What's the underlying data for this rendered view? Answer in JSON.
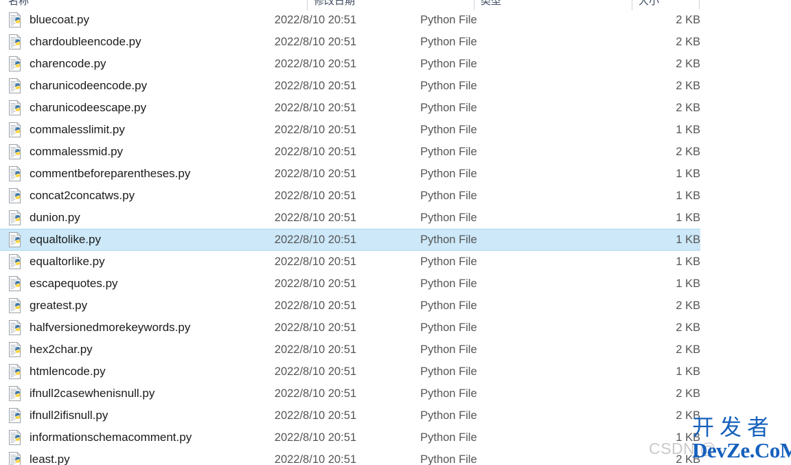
{
  "window": {
    "view": "details",
    "accent_selection_bg": "#cce8f9",
    "accent_selection_border": "#a8d8f0",
    "header_text_color": "#3b4a5e"
  },
  "columns": [
    {
      "key": "name",
      "label": "名称"
    },
    {
      "key": "date",
      "label": "修改日期"
    },
    {
      "key": "type",
      "label": "类型"
    },
    {
      "key": "size",
      "label": "大小"
    }
  ],
  "files": [
    {
      "icon": "python-file-icon",
      "name": "bluecoat.py",
      "date": "2022/8/10 20:51",
      "type": "Python File",
      "size": "2 KB",
      "selected": false
    },
    {
      "icon": "python-file-icon",
      "name": "chardoubleencode.py",
      "date": "2022/8/10 20:51",
      "type": "Python File",
      "size": "2 KB",
      "selected": false
    },
    {
      "icon": "python-file-icon",
      "name": "charencode.py",
      "date": "2022/8/10 20:51",
      "type": "Python File",
      "size": "2 KB",
      "selected": false
    },
    {
      "icon": "python-file-icon",
      "name": "charunicodeencode.py",
      "date": "2022/8/10 20:51",
      "type": "Python File",
      "size": "2 KB",
      "selected": false
    },
    {
      "icon": "python-file-icon",
      "name": "charunicodeescape.py",
      "date": "2022/8/10 20:51",
      "type": "Python File",
      "size": "2 KB",
      "selected": false
    },
    {
      "icon": "python-file-icon",
      "name": "commalesslimit.py",
      "date": "2022/8/10 20:51",
      "type": "Python File",
      "size": "1 KB",
      "selected": false
    },
    {
      "icon": "python-file-icon",
      "name": "commalessmid.py",
      "date": "2022/8/10 20:51",
      "type": "Python File",
      "size": "2 KB",
      "selected": false
    },
    {
      "icon": "python-file-icon",
      "name": "commentbeforeparentheses.py",
      "date": "2022/8/10 20:51",
      "type": "Python File",
      "size": "1 KB",
      "selected": false
    },
    {
      "icon": "python-file-icon",
      "name": "concat2concatws.py",
      "date": "2022/8/10 20:51",
      "type": "Python File",
      "size": "1 KB",
      "selected": false
    },
    {
      "icon": "python-file-icon",
      "name": "dunion.py",
      "date": "2022/8/10 20:51",
      "type": "Python File",
      "size": "1 KB",
      "selected": false
    },
    {
      "icon": "python-file-icon",
      "name": "equaltolike.py",
      "date": "2022/8/10 20:51",
      "type": "Python File",
      "size": "1 KB",
      "selected": true
    },
    {
      "icon": "python-file-icon",
      "name": "equaltorlike.py",
      "date": "2022/8/10 20:51",
      "type": "Python File",
      "size": "1 KB",
      "selected": false
    },
    {
      "icon": "python-file-icon",
      "name": "escapequotes.py",
      "date": "2022/8/10 20:51",
      "type": "Python File",
      "size": "1 KB",
      "selected": false
    },
    {
      "icon": "python-file-icon",
      "name": "greatest.py",
      "date": "2022/8/10 20:51",
      "type": "Python File",
      "size": "2 KB",
      "selected": false
    },
    {
      "icon": "python-file-icon",
      "name": "halfversionedmorekeywords.py",
      "date": "2022/8/10 20:51",
      "type": "Python File",
      "size": "2 KB",
      "selected": false
    },
    {
      "icon": "python-file-icon",
      "name": "hex2char.py",
      "date": "2022/8/10 20:51",
      "type": "Python File",
      "size": "2 KB",
      "selected": false
    },
    {
      "icon": "python-file-icon",
      "name": "htmlencode.py",
      "date": "2022/8/10 20:51",
      "type": "Python File",
      "size": "1 KB",
      "selected": false
    },
    {
      "icon": "python-file-icon",
      "name": "ifnull2casewhenisnull.py",
      "date": "2022/8/10 20:51",
      "type": "Python File",
      "size": "2 KB",
      "selected": false
    },
    {
      "icon": "python-file-icon",
      "name": "ifnull2ifisnull.py",
      "date": "2022/8/10 20:51",
      "type": "Python File",
      "size": "2 KB",
      "selected": false
    },
    {
      "icon": "python-file-icon",
      "name": "informationschemacomment.py",
      "date": "2022/8/10 20:51",
      "type": "Python File",
      "size": "1 KB",
      "selected": false
    },
    {
      "icon": "python-file-icon",
      "name": "least.py",
      "date": "2022/8/10 20:51",
      "type": "Python File",
      "size": "2 KB",
      "selected": false
    }
  ],
  "watermarks": {
    "csdn": "CSDN @",
    "brand_cn": "开发者",
    "brand_en": "DevZe.CoM",
    "brand_color": "#1560bd",
    "csdn_color": "#c9c9c9"
  }
}
